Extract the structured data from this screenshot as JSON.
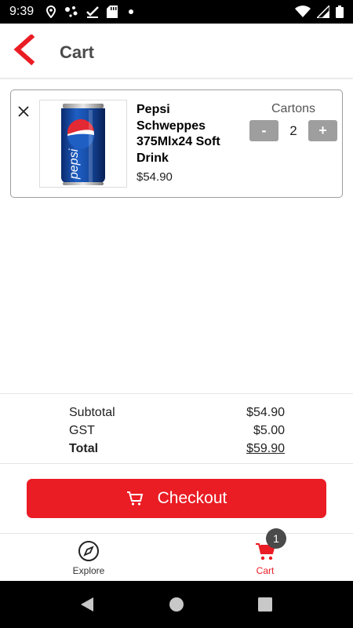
{
  "status_bar": {
    "time": "9:39",
    "left_icons": [
      "location-pin-icon",
      "assistant-dots-icon",
      "checkmark-icon",
      "sd-card-icon",
      "dot-icon"
    ],
    "right_icons": [
      "wifi-icon",
      "signal-icon",
      "battery-icon"
    ]
  },
  "header": {
    "title": "Cart",
    "back_icon": "chevron-left-icon"
  },
  "cart_items": [
    {
      "name": "Pepsi Schweppes 375Mlx24 Soft Drink",
      "price": "$54.90",
      "unit_label": "Cartons",
      "quantity": "2",
      "minus_label": "-",
      "plus_label": "+",
      "image": "pepsi-can-image"
    }
  ],
  "summary": {
    "subtotal_label": "Subtotal",
    "subtotal_value": "$54.90",
    "gst_label": "GST",
    "gst_value": "$5.00",
    "total_label": "Total",
    "total_value": "$59.90"
  },
  "checkout": {
    "label": "Checkout",
    "icon": "cart-icon"
  },
  "bottom_nav": {
    "items": [
      {
        "label": "Explore",
        "icon": "compass-icon",
        "active": false
      },
      {
        "label": "Cart",
        "icon": "cart-icon",
        "active": true,
        "badge": "1"
      }
    ]
  },
  "colors": {
    "accent": "#ea1c24",
    "qty_button": "#9e9e9e",
    "badge": "#4a4a4a",
    "title": "#4a4a4a"
  }
}
